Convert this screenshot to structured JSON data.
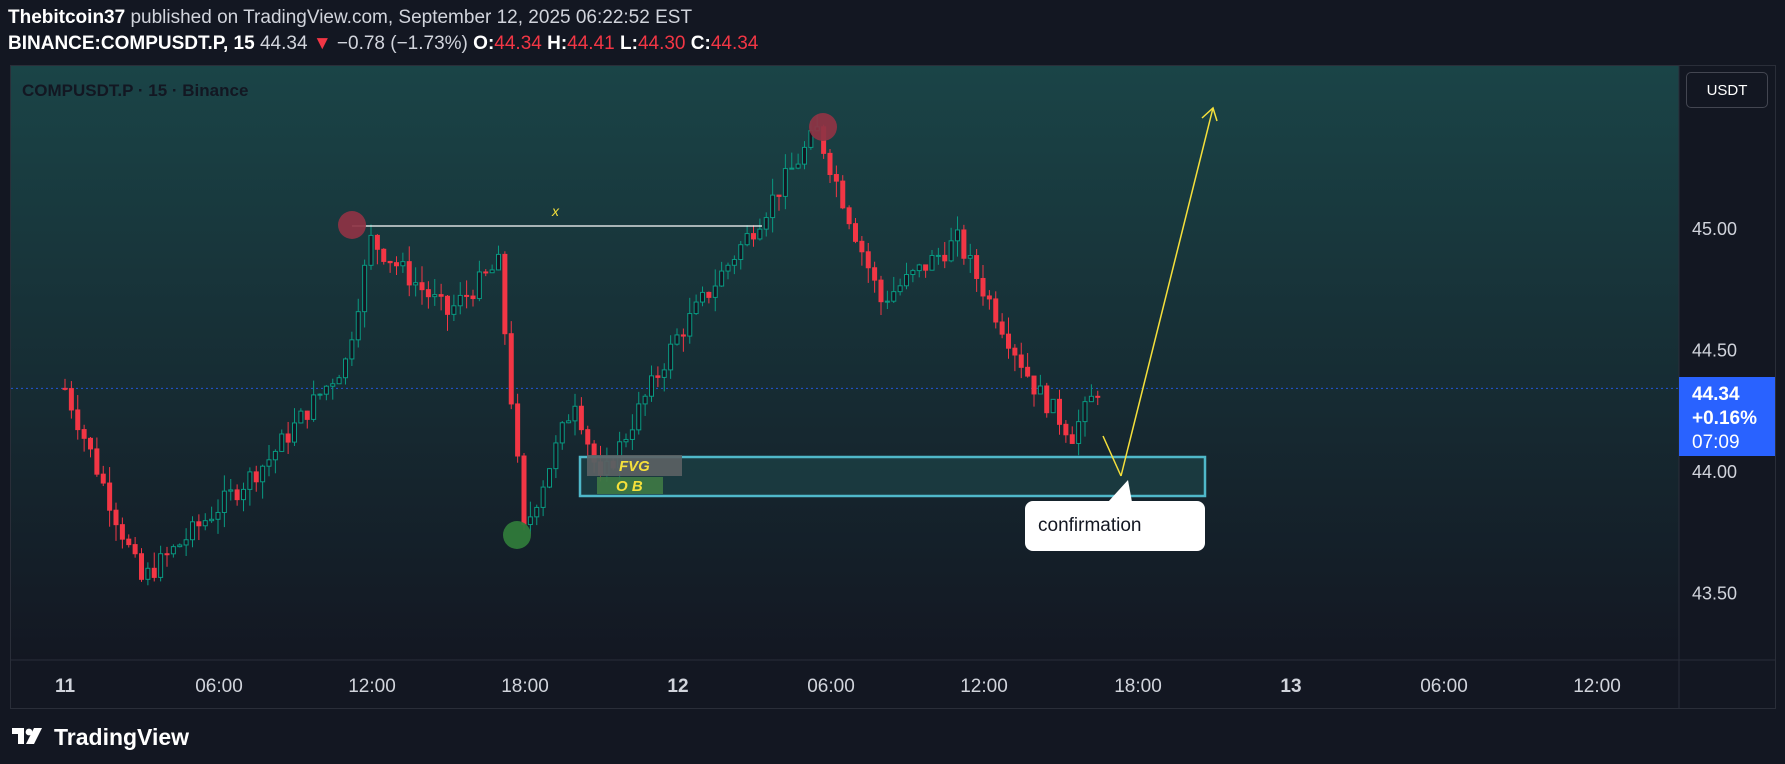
{
  "header": {
    "author": "Thebitcoin37",
    "published_text": "published on TradingView.com, September 12, 2025 06:22:52 EST",
    "symbol": "BINANCE:COMPUSDT.P, 15",
    "price": "44.34",
    "change": "−0.78 (−1.73%)",
    "open_label": "O:",
    "open": "44.34",
    "high_label": "H:",
    "high": "44.41",
    "low_label": "L:",
    "low": "44.30",
    "close_label": "C:",
    "close": "44.34"
  },
  "chart_title": "COMPUSDT.P · 15 · Binance",
  "currency_button": "USDT",
  "price_label": {
    "price": "44.34",
    "change": "+0.16%",
    "timer": "07:09"
  },
  "logo_text": "TradingView",
  "colors": {
    "up": "#089981",
    "down": "#f23645",
    "accent": "#2962ff",
    "annotation": "#f5e03b",
    "zone": "#4fb8c9"
  },
  "chart_data": {
    "type": "candlestick",
    "title": "COMPUSDT.P · 15 · Binance",
    "y_ticks": [
      "45.00",
      "44.50",
      "44.00",
      "43.50"
    ],
    "x_ticks": [
      "11",
      "06:00",
      "12:00",
      "18:00",
      "12",
      "06:00",
      "12:00",
      "18:00",
      "13",
      "06:00",
      "12:00"
    ],
    "ylim": [
      43.2,
      45.7
    ],
    "current_price": 44.34,
    "key_closes": [
      {
        "time": "11 00:00",
        "price": 44.34
      },
      {
        "time": "11 03:00",
        "price": 43.55
      },
      {
        "time": "11 08:00",
        "price": 44.05
      },
      {
        "time": "11 11:00",
        "price": 44.45
      },
      {
        "time": "11 12:00",
        "price": 44.95
      },
      {
        "time": "11 15:00",
        "price": 44.65
      },
      {
        "time": "11 17:00",
        "price": 44.85
      },
      {
        "time": "11 18:00",
        "price": 43.75
      },
      {
        "time": "11 20:00",
        "price": 44.3
      },
      {
        "time": "11 21:00",
        "price": 43.95
      },
      {
        "time": "12 00:00",
        "price": 44.55
      },
      {
        "time": "12 03:00",
        "price": 45.0
      },
      {
        "time": "12 05:30",
        "price": 45.4
      },
      {
        "time": "12 08:00",
        "price": 44.7
      },
      {
        "time": "12 11:00",
        "price": 44.95
      },
      {
        "time": "12 14:00",
        "price": 44.35
      },
      {
        "time": "12 15:30",
        "price": 44.15
      },
      {
        "time": "12 16:30",
        "price": 44.34
      }
    ],
    "annotations": {
      "level_label": "x",
      "fvg_label": "FVG",
      "ob_label": "O B",
      "callout": "confirmation"
    }
  }
}
